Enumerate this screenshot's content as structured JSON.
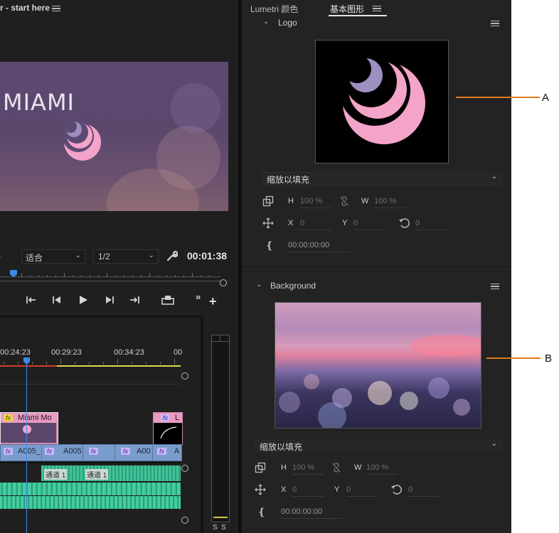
{
  "program_monitor": {
    "title": "r - start here",
    "preview_text": "MIAMI",
    "fit_select": "适合",
    "resolution_select": "1/2",
    "timecode": "00:01:38"
  },
  "timeline": {
    "ruler": [
      "00:24:23",
      "00:29:23",
      "00:34:23",
      "00"
    ],
    "clips": {
      "graphic_clip": "Miami Mo",
      "graphic_clip_2": "L",
      "video_clips": [
        "A005_",
        "A005",
        "A00",
        "A"
      ],
      "audio_labels": [
        "通道 1",
        "通道 1"
      ]
    },
    "fx_label": "fx",
    "meter_labels": [
      "S",
      "S"
    ]
  },
  "tabs": {
    "lumetri": "Lumetri 颜色",
    "essential_graphics": "基本图形"
  },
  "logo_section": {
    "title": "Logo",
    "scale_select": "缩放以填充",
    "h_label": "H",
    "h_value": "100 %",
    "w_label": "W",
    "w_value": "100 %",
    "x_label": "X",
    "x_value": "0",
    "y_label": "Y",
    "y_value": "0",
    "rotation_value": "0",
    "timecode": "00:00:00:00"
  },
  "background_section": {
    "title": "Background",
    "scale_select": "缩放以填充",
    "h_label": "H",
    "h_value": "100 %",
    "w_label": "W",
    "w_value": "100 %",
    "x_label": "X",
    "x_value": "0",
    "y_label": "Y",
    "y_value": "0",
    "rotation_value": "0",
    "timecode": "00:00:00:00"
  },
  "callouts": {
    "a": "A",
    "b": "B"
  },
  "colors": {
    "accent_blue": "#4d8fe0",
    "logo_pink": "#f4a3c9",
    "logo_lilac": "#9f8ec0",
    "audio_green": "#3fc49a",
    "callout_orange": "#e07a1f"
  },
  "icons": [
    "hamburger-icon",
    "chevron-down-icon",
    "wrench-icon",
    "step-back-icon",
    "play-icon",
    "step-forward-icon",
    "export-frame-icon",
    "add-icon",
    "scale-icon",
    "link-icon",
    "move-icon",
    "rotate-icon",
    "anchor-icon"
  ]
}
